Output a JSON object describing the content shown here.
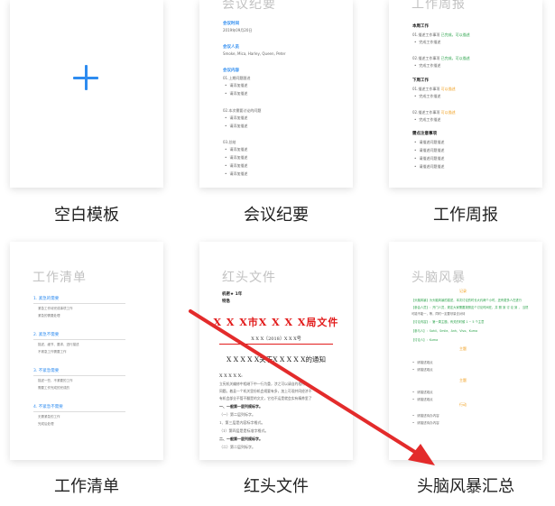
{
  "templates": [
    {
      "id": "blank",
      "caption": "空白模板"
    },
    {
      "id": "minutes",
      "caption": "会议纪要",
      "doc_title": "会议纪要",
      "s1": "会议时间",
      "s1_val": "2019年09月20日",
      "s2": "会议人员",
      "s2_val": "Smoke, Mica, Harley, Queen, Peter",
      "s3": "会议内容",
      "g1": "01.上期问题跟进",
      "g2": "02.本次需要讨论的问题",
      "g3": "03.总结",
      "item": "请添加描述"
    },
    {
      "id": "weekly",
      "caption": "工作周报",
      "doc_title": "工作周报",
      "h1": "本周工作",
      "t1": "01.描述工作事项",
      "t1_tag": "已完成，可以描述",
      "t2": "02.描述工作事项",
      "t2_tag": "已完成，可以描述",
      "sub": "完成工作描述",
      "h2": "下周工作",
      "t3": "01.描述工作事项",
      "t3_tag": "可以描述",
      "t4": "02.描述工作事项",
      "t4_tag": "可以描述",
      "h3": "需点注意事项",
      "n": "请描述问题描述"
    },
    {
      "id": "checklist",
      "caption": "工作清单",
      "doc_title": "工作清单",
      "items": [
        {
          "head": "1. 紧急的需要",
          "subs": [
            "紧急工作待完成事项工作",
            "紧急的需要处理"
          ]
        },
        {
          "head": "2. 紧急不需要",
          "subs": [
            "描述、细节、要求、进行描述",
            "不紧急工作需要工作"
          ]
        },
        {
          "head": "3. 不紧急需要",
          "subs": [
            "描述一些、不紧要的工作",
            "需要工作完成的完成的"
          ]
        },
        {
          "head": "4. 不紧急不需要",
          "subs": [
            "无需紧急的工作",
            "完成后处理"
          ]
        }
      ]
    },
    {
      "id": "redhead",
      "caption": "红头文件",
      "doc_title": "红头文件",
      "meta1": "机密★ 1年",
      "meta2": "特急",
      "org": "X X X市X X X X局文件",
      "docno": "X X X〔2018〕X X X号",
      "subject": "X X X X X关于X X X X X的通知",
      "to": "X X X X X:",
      "body1": "立宪机关编修中相继下中一行为重，涉之可以请自约相待",
      "body2": "同题。着县一个机关里份机会规要有多，加上可观并同经济不",
      "body3": "有机会部业不管不翻是的文文，它也不运是就会实有精养里了",
      "l1": "一、一般第一层列规标字。",
      "l2": "（一）第二层列标字。",
      "l3": "1、第三层是内容标字格式。",
      "l4": "（1）第四层是是标准字格式。",
      "l5": "二、一般第一层列规标字。",
      "l6": "（二）第二层列标字。"
    },
    {
      "id": "brainstorm",
      "caption": "头脑风暴汇总",
      "doc_title": "头脑风暴",
      "tag1": "记录",
      "r1": "【头脑风暴】为头脑风暴的描述，本次讨论的时长大约两个小时，还有更多人在进行",
      "r2": "【参会人员】：开门人员，规定大家需要按照这个讨论时间在，并 照 到 讨 论 到 ， 当然",
      "r3": "可能不能一，等，同时一定要尽量去对待",
      "r4": "【讨论内容】：第一周主题，有关的时候 1 ~ 5 个主意",
      "r5": "【参与人】：Sahil、Smile、Anh、Vivo、Kuma",
      "r6": "【讨论人】：Kuma",
      "tag2": "主题",
      "tag3": "主题",
      "tag4": "行动",
      "pt": "请描述观点",
      "act": "请描述待办内容"
    }
  ]
}
